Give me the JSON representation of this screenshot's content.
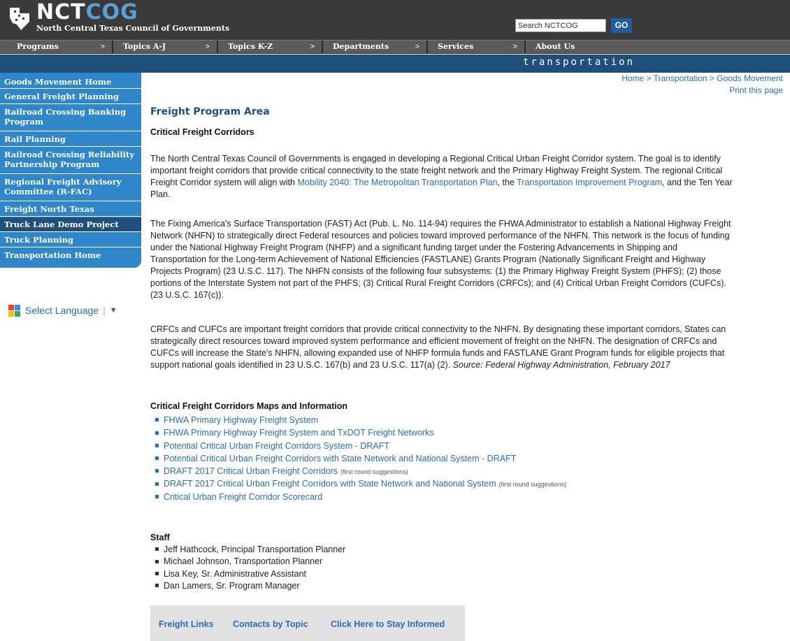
{
  "header": {
    "logo_text_white": "NCT",
    "logo_text_blue": "COG",
    "logo_subtitle": "North Central Texas Council of Governments",
    "search_value": "Search NCTCOG",
    "go_label": "GO"
  },
  "topnav": [
    {
      "label": "Programs",
      "arrow": ">"
    },
    {
      "label": "Topics A-J",
      "arrow": ">"
    },
    {
      "label": "Topics K-Z",
      "arrow": ">"
    },
    {
      "label": "Departments",
      "arrow": ">"
    },
    {
      "label": "Services",
      "arrow": ">"
    },
    {
      "label": "About Us",
      "arrow": ""
    }
  ],
  "banner": "transportation",
  "sidebar": {
    "items": [
      {
        "label": "Goods Movement Home"
      },
      {
        "label": "General Freight Planning"
      },
      {
        "label": "Railroad Crossing Banking Program"
      },
      {
        "label": "Rail Planning"
      },
      {
        "label": "Railroad Crossing Reliability Partnership Program"
      },
      {
        "label": "Regional Freight Advisory Committee (R-FAC)"
      },
      {
        "label": "Freight North Texas"
      },
      {
        "label": "Truck Lane Demo Project"
      },
      {
        "label": "Truck Planning"
      },
      {
        "label": "Transportation Home"
      }
    ],
    "language_label": "Select Language",
    "language_arrow": "▼"
  },
  "breadcrumb": "Home > Transportation > Goods Movement",
  "print_label": "Print this page",
  "main": {
    "title": "Freight Program Area",
    "subtitle": "Critical Freight Corridors",
    "p1_a": "The North Central Texas Council of Governments is engaged in developing a Regional Critical Urban Freight Corridor system.  The goal is to identify important freight corridors that provide critical connectivity to the state freight network and the Primary Highway Freight System.  The regional Critical Freight Corridor system will align with ",
    "p1_link1": "Mobility 2040: The Metropolitan Transportation Plan",
    "p1_b": ", the ",
    "p1_link2": "Transportation Improvement Program",
    "p1_c": ", and the Ten Year Plan.",
    "p2": "The Fixing America's Surface Transportation (FAST) Act (Pub. L. No. 114-94) requires the FHWA Administrator to establish a National Highway Freight Network (NHFN) to strategically direct Federal resources and policies toward improved performance of the NHFN. This network is the focus of funding under the National Highway Freight Program (NHFP) and a significant funding target under the Fostering Advancements in Shipping and Transportation for the Long-term Achievement of National Efficiencies (FASTLANE) Grants Program (Nationally Significant Freight and Highway Projects Program) (23 U.S.C. 117). The NHFN consists of the following four subsystems: (1) the Primary Highway Freight System (PHFS); (2) those portions of the Interstate System not part of the PHFS; (3) Critical Rural Freight Corridors (CRFCs); and (4) Critical Urban Freight Corridors (CUFCs). (23 U.S.C. 167(c)).",
    "p3": "CRFCs and CUFCs are important freight corridors that provide critical connectivity to the NHFN. By designating these important corridors, States can strategically direct resources toward improved system performance and efficient movement of freight on the NHFN. The designation of CRFCs and CUFCs will increase the State's NHFN, allowing expanded use of NHFP formula funds and FASTLANE Grant Program funds for eligible projects that support national goals identified in 23 U.S.C. 167(b) and 23 U.S.C. 117(a) (2).  ",
    "p3_source": "Source: Federal Highway Administration, February 2017",
    "maps_title": "Critical Freight Corridors Maps and Information",
    "maps": [
      {
        "label": "FHWA Primary Highway Freight System",
        "note": ""
      },
      {
        "label": "FHWA Primary Highway Freight System and TxDOT Freight Networks",
        "note": ""
      },
      {
        "label": "Potential Critical Urban Freight Corridors System - DRAFT",
        "note": ""
      },
      {
        "label": "Potential Critical Urban Freight Corridors with State Network and National System - DRAFT",
        "note": ""
      },
      {
        "label": "DRAFT 2017 Critical Urban Freight Corridors",
        "note": "(first round suggestions)"
      },
      {
        "label": "DRAFT 2017 Critical Urban Freight Corridors with State Network and National System",
        "note": "(first round suggestions)"
      },
      {
        "label": "Critical Urban Freight Corridor Scorecard",
        "note": ""
      }
    ],
    "staff_title": "Staff",
    "staff": [
      "Jeff Hathcock, Principal Transportation Planner",
      "Michael Johnson, Transportation Planner",
      "Lisa Key, Sr. Administrative Assistant",
      "Dan Lamers, Sr. Program Manager"
    ]
  },
  "footer_links": [
    "Freight Links",
    "Contacts by Topic",
    "Click Here to Stay Informed"
  ]
}
